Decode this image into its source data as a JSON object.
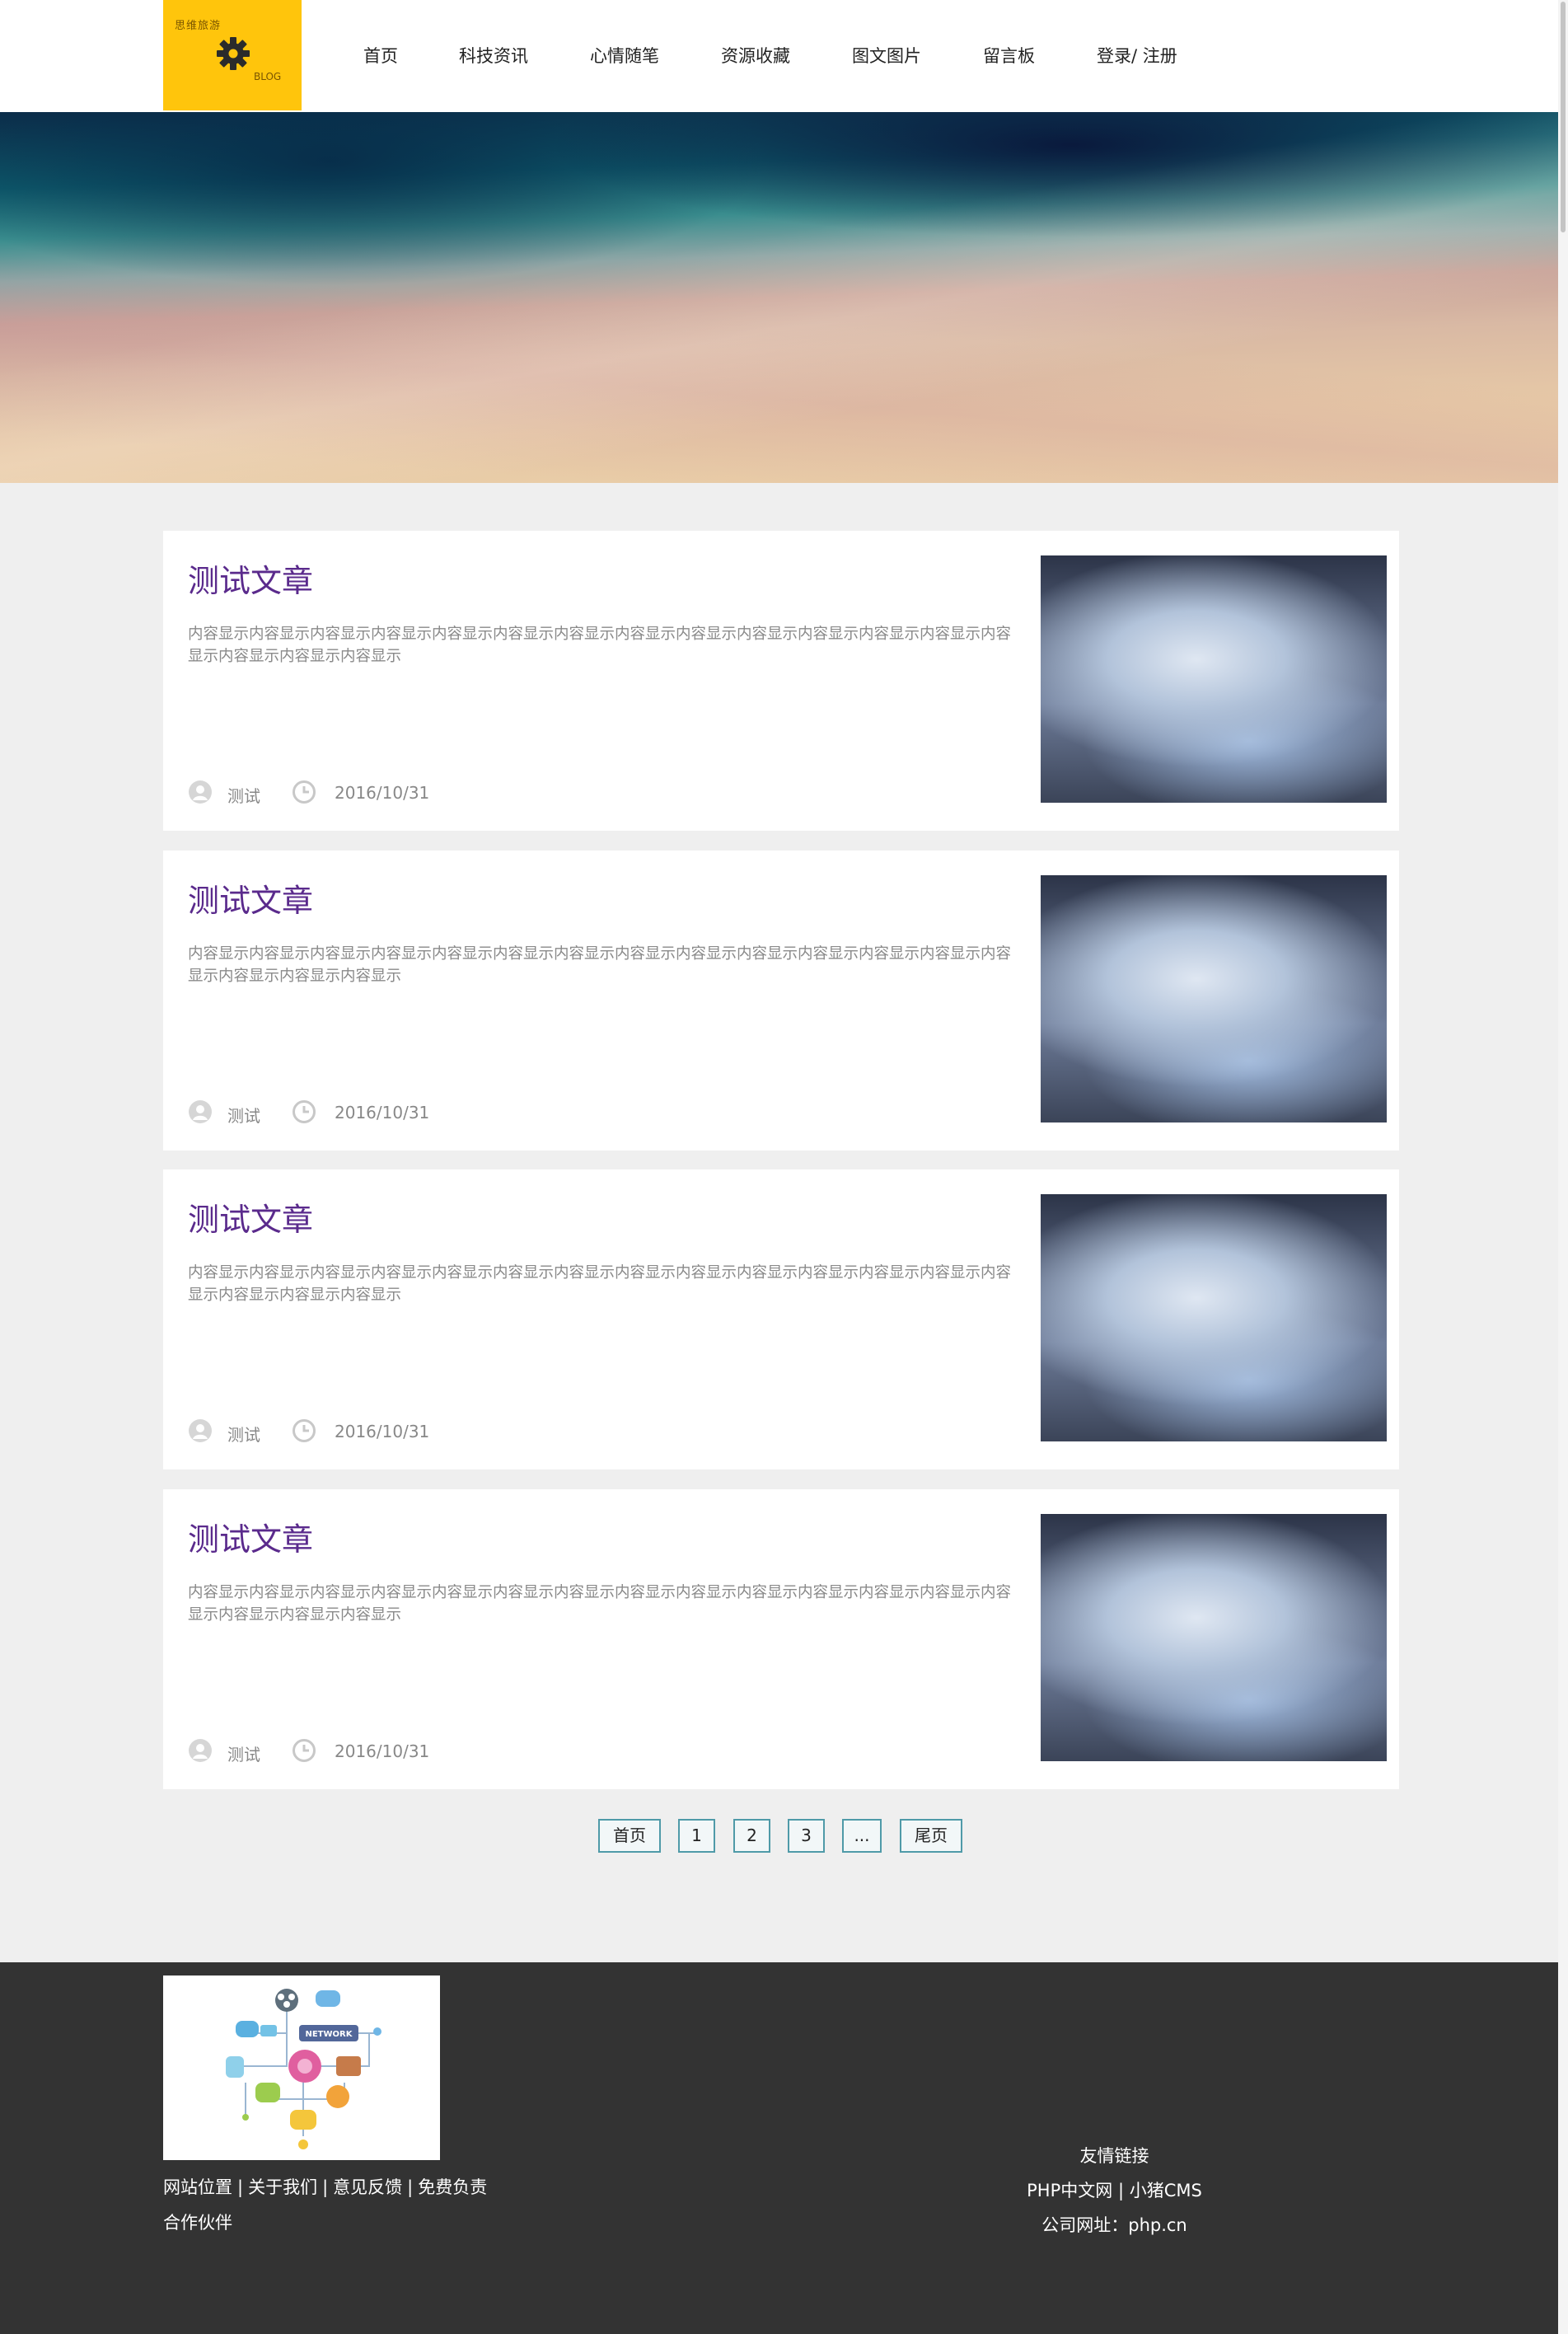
{
  "logo": {
    "top_text": "思维旅游",
    "bottom_text": "BLOG",
    "accent_color": "#ffc50c",
    "icon": "gear-icon"
  },
  "nav": [
    {
      "label": "首页"
    },
    {
      "label": "科技资讯"
    },
    {
      "label": "心情随笔"
    },
    {
      "label": "资源收藏"
    },
    {
      "label": "图文图片"
    },
    {
      "label": "留言板"
    },
    {
      "label": "登录/ 注册"
    }
  ],
  "articles": [
    {
      "title": "测试文章",
      "content": "内容显示内容显示内容显示内容显示内容显示内容显示内容显示内容显示内容显示内容显示内容显示内容显示内容显示内容显示内容显示内容显示内容显示",
      "author": "测试",
      "date": "2016/10/31"
    },
    {
      "title": "测试文章",
      "content": "内容显示内容显示内容显示内容显示内容显示内容显示内容显示内容显示内容显示内容显示内容显示内容显示内容显示内容显示内容显示内容显示内容显示",
      "author": "测试",
      "date": "2016/10/31"
    },
    {
      "title": "测试文章",
      "content": "内容显示内容显示内容显示内容显示内容显示内容显示内容显示内容显示内容显示内容显示内容显示内容显示内容显示内容显示内容显示内容显示内容显示",
      "author": "测试",
      "date": "2016/10/31"
    },
    {
      "title": "测试文章",
      "content": "内容显示内容显示内容显示内容显示内容显示内容显示内容显示内容显示内容显示内容显示内容显示内容显示内容显示内容显示内容显示内容显示内容显示",
      "author": "测试",
      "date": "2016/10/31"
    }
  ],
  "pagination": {
    "first": "首页",
    "pages": [
      "1",
      "2",
      "3"
    ],
    "ellipsis": "...",
    "last": "尾页"
  },
  "footer": {
    "image_label": "NETWORK",
    "links": [
      "网站位置",
      "关于我们",
      "意见反馈",
      "免费负责"
    ],
    "separator": "|",
    "partner": "合作伙伴",
    "friend_links_title": "友情链接",
    "friend_links": [
      "PHP中文网",
      "小猪CMS"
    ],
    "address_label": "公司网址：",
    "address": "php.cn"
  },
  "colors": {
    "title": "#5a2a8c",
    "page_bg": "#efefef",
    "footer_bg": "#333333",
    "pager_border": "#4f9aa8"
  }
}
